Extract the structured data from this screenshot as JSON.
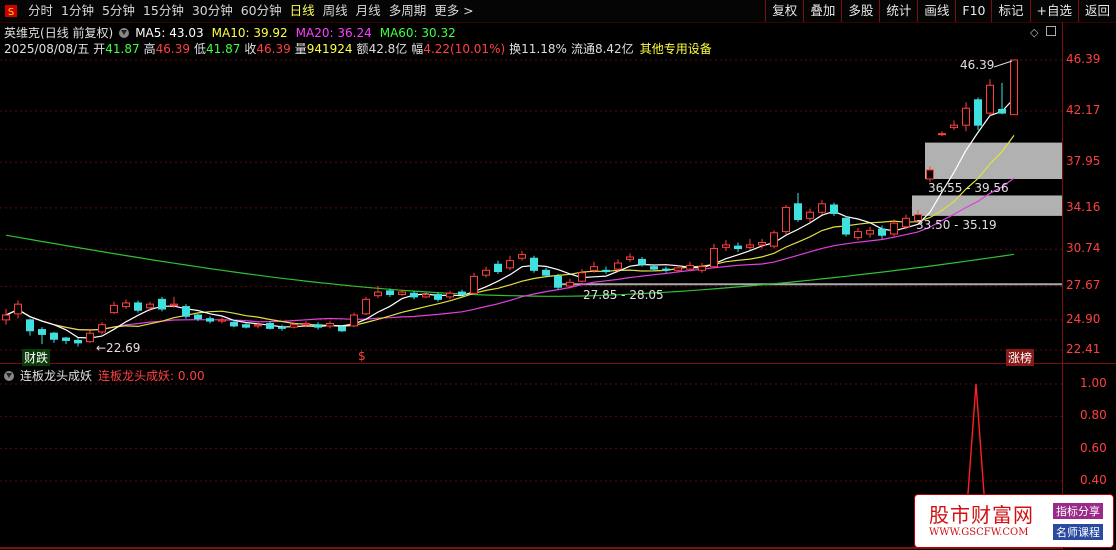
{
  "toolbar": {
    "left_items": [
      "分时",
      "1分钟",
      "5分钟",
      "15分钟",
      "30分钟",
      "60分钟",
      "日线",
      "周线",
      "月线",
      "多周期",
      "更多 >"
    ],
    "active_item": "日线",
    "right_buttons": [
      "复权",
      "叠加",
      "多股",
      "统计",
      "画线",
      "F10",
      "标记",
      "+自选",
      "返回"
    ]
  },
  "stock": {
    "name": "英维克",
    "mode": "(日线 前复权)",
    "ma": [
      {
        "label": "MA5: 43.03",
        "color": "#ffffff"
      },
      {
        "label": "MA10: 39.92",
        "color": "#ffff40"
      },
      {
        "label": "MA20: 36.24",
        "color": "#ff40ff"
      },
      {
        "label": "MA60: 30.32",
        "color": "#40ff40"
      }
    ],
    "date": "2025/08/08/五",
    "quote": [
      {
        "label": "开",
        "value": "41.87",
        "color": "#40ff40"
      },
      {
        "label": "高",
        "value": "46.39",
        "color": "#ff4040"
      },
      {
        "label": "低",
        "value": "41.87",
        "color": "#40ff40"
      },
      {
        "label": "收",
        "value": "46.39",
        "color": "#ff4040"
      },
      {
        "label": "量",
        "value": "941924",
        "color": "#ffff40"
      },
      {
        "label": "额",
        "value": "42.8亿",
        "color": "#dddddd"
      },
      {
        "label": "幅",
        "value": "4.22(10.01%)",
        "color": "#ff4040"
      },
      {
        "label": "换",
        "value": "11.18%",
        "color": "#dddddd"
      },
      {
        "label": "流通",
        "value": "8.42亿",
        "color": "#dddddd"
      }
    ],
    "concept": "其他专用设备"
  },
  "price_axis": [
    "46.39",
    "42.17",
    "37.95",
    "34.16",
    "30.74",
    "27.67",
    "24.90",
    "22.41"
  ],
  "annotations": {
    "high_label": "46.39",
    "low_label": "←22.69",
    "zone1": "36.55 - 39.56",
    "zone2": "33.50 - 35.19",
    "zone3": "27.85 - 28.05",
    "bottom_left_tag": "财跌",
    "bottom_mid_tag": "$",
    "bottom_right_tag": "涨榜"
  },
  "indicator": {
    "name": "连板龙头成妖",
    "value_label": "连板龙头成妖: 0.00",
    "axis": [
      "1.00",
      "0.80",
      "0.60",
      "0.40"
    ]
  },
  "watermark": {
    "main": "股市财富网",
    "url": "WWW.GSCFW.COM",
    "badge1": "指标分享",
    "badge2": "名师课程"
  },
  "chart_data": {
    "type": "candlestick",
    "price_axis_ticks": [
      46.39,
      42.17,
      37.95,
      34.16,
      30.74,
      27.67,
      24.9,
      22.41
    ],
    "candles": [
      {
        "o": 24.9,
        "c": 25.3,
        "h": 25.8,
        "l": 24.5
      },
      {
        "o": 25.4,
        "c": 26.2,
        "h": 26.5,
        "l": 25.0
      },
      {
        "o": 24.9,
        "c": 24.0,
        "h": 25.0,
        "l": 23.6
      },
      {
        "o": 24.1,
        "c": 23.7,
        "h": 24.3,
        "l": 22.9
      },
      {
        "o": 23.8,
        "c": 23.3,
        "h": 23.9,
        "l": 23.0
      },
      {
        "o": 23.4,
        "c": 23.2,
        "h": 23.5,
        "l": 22.9
      },
      {
        "o": 23.2,
        "c": 23.0,
        "h": 23.4,
        "l": 22.69
      },
      {
        "o": 23.1,
        "c": 23.8,
        "h": 24.0,
        "l": 23.0
      },
      {
        "o": 23.9,
        "c": 24.5,
        "h": 24.7,
        "l": 23.7
      },
      {
        "o": 25.5,
        "c": 26.1,
        "h": 26.4,
        "l": 25.4
      },
      {
        "o": 26.0,
        "c": 26.3,
        "h": 26.6,
        "l": 25.8
      },
      {
        "o": 26.3,
        "c": 25.7,
        "h": 26.5,
        "l": 25.5
      },
      {
        "o": 25.9,
        "c": 26.2,
        "h": 26.4,
        "l": 25.6
      },
      {
        "o": 26.6,
        "c": 25.8,
        "h": 26.8,
        "l": 25.6
      },
      {
        "o": 26.1,
        "c": 26.2,
        "h": 26.8,
        "l": 25.9
      },
      {
        "o": 26.0,
        "c": 25.2,
        "h": 26.2,
        "l": 25.0
      },
      {
        "o": 25.3,
        "c": 25.0,
        "h": 25.4,
        "l": 24.8
      },
      {
        "o": 25.0,
        "c": 24.8,
        "h": 25.2,
        "l": 24.6
      },
      {
        "o": 24.8,
        "c": 24.9,
        "h": 25.1,
        "l": 24.6
      },
      {
        "o": 24.7,
        "c": 24.4,
        "h": 24.9,
        "l": 24.3
      },
      {
        "o": 24.5,
        "c": 24.3,
        "h": 24.7,
        "l": 24.2
      },
      {
        "o": 24.4,
        "c": 24.5,
        "h": 24.7,
        "l": 24.2
      },
      {
        "o": 24.6,
        "c": 24.2,
        "h": 24.8,
        "l": 24.1
      },
      {
        "o": 24.3,
        "c": 24.2,
        "h": 24.5,
        "l": 24.0
      },
      {
        "o": 24.3,
        "c": 24.5,
        "h": 24.7,
        "l": 24.2
      },
      {
        "o": 24.5,
        "c": 24.6,
        "h": 24.8,
        "l": 24.3
      },
      {
        "o": 24.5,
        "c": 24.3,
        "h": 24.7,
        "l": 24.1
      },
      {
        "o": 24.4,
        "c": 24.6,
        "h": 24.8,
        "l": 24.2
      },
      {
        "o": 24.3,
        "c": 24.0,
        "h": 24.4,
        "l": 23.9
      },
      {
        "o": 24.4,
        "c": 25.3,
        "h": 25.5,
        "l": 24.3
      },
      {
        "o": 25.4,
        "c": 26.6,
        "h": 26.8,
        "l": 25.3
      },
      {
        "o": 26.9,
        "c": 27.2,
        "h": 27.7,
        "l": 26.7
      },
      {
        "o": 27.3,
        "c": 27.0,
        "h": 27.5,
        "l": 26.8
      },
      {
        "o": 27.0,
        "c": 27.2,
        "h": 27.4,
        "l": 26.9
      },
      {
        "o": 27.1,
        "c": 26.8,
        "h": 27.3,
        "l": 26.6
      },
      {
        "o": 26.8,
        "c": 27.0,
        "h": 27.2,
        "l": 26.7
      },
      {
        "o": 27.0,
        "c": 26.6,
        "h": 27.2,
        "l": 26.4
      },
      {
        "o": 26.8,
        "c": 27.1,
        "h": 27.3,
        "l": 26.6
      },
      {
        "o": 27.2,
        "c": 27.0,
        "h": 27.4,
        "l": 26.9
      },
      {
        "o": 27.1,
        "c": 28.5,
        "h": 28.8,
        "l": 27.0
      },
      {
        "o": 28.6,
        "c": 29.0,
        "h": 29.3,
        "l": 28.4
      },
      {
        "o": 29.5,
        "c": 28.9,
        "h": 29.8,
        "l": 28.7
      },
      {
        "o": 29.2,
        "c": 29.8,
        "h": 30.2,
        "l": 29.0
      },
      {
        "o": 30.0,
        "c": 30.3,
        "h": 30.6,
        "l": 29.8
      },
      {
        "o": 30.0,
        "c": 29.0,
        "h": 30.2,
        "l": 28.8
      },
      {
        "o": 29.0,
        "c": 28.6,
        "h": 29.2,
        "l": 28.4
      },
      {
        "o": 28.5,
        "c": 27.6,
        "h": 28.7,
        "l": 27.4
      },
      {
        "o": 27.7,
        "c": 28.0,
        "h": 28.3,
        "l": 27.5
      },
      {
        "o": 28.1,
        "c": 28.8,
        "h": 29.1,
        "l": 28.0
      },
      {
        "o": 29.0,
        "c": 29.3,
        "h": 29.7,
        "l": 28.8
      },
      {
        "o": 29.0,
        "c": 28.9,
        "h": 29.3,
        "l": 28.7
      },
      {
        "o": 29.1,
        "c": 29.6,
        "h": 29.9,
        "l": 28.9
      },
      {
        "o": 29.9,
        "c": 30.1,
        "h": 30.4,
        "l": 29.7
      },
      {
        "o": 29.9,
        "c": 29.5,
        "h": 30.1,
        "l": 29.3
      },
      {
        "o": 29.3,
        "c": 29.1,
        "h": 29.5,
        "l": 28.9
      },
      {
        "o": 29.1,
        "c": 29.0,
        "h": 29.3,
        "l": 28.8
      },
      {
        "o": 29.0,
        "c": 29.2,
        "h": 29.4,
        "l": 28.8
      },
      {
        "o": 29.1,
        "c": 29.4,
        "h": 29.7,
        "l": 28.9
      },
      {
        "o": 29.0,
        "c": 29.3,
        "h": 29.6,
        "l": 28.8
      },
      {
        "o": 29.3,
        "c": 30.8,
        "h": 31.2,
        "l": 29.2
      },
      {
        "o": 30.9,
        "c": 31.1,
        "h": 31.5,
        "l": 30.6
      },
      {
        "o": 31.0,
        "c": 30.8,
        "h": 31.3,
        "l": 30.5
      },
      {
        "o": 30.9,
        "c": 31.1,
        "h": 31.6,
        "l": 30.7
      },
      {
        "o": 31.1,
        "c": 31.3,
        "h": 31.6,
        "l": 30.8
      },
      {
        "o": 31.0,
        "c": 32.1,
        "h": 32.3,
        "l": 30.8
      },
      {
        "o": 32.2,
        "c": 34.2,
        "h": 34.4,
        "l": 32.0
      },
      {
        "o": 34.5,
        "c": 33.2,
        "h": 35.4,
        "l": 33.0
      },
      {
        "o": 33.3,
        "c": 33.8,
        "h": 34.1,
        "l": 33.0
      },
      {
        "o": 33.8,
        "c": 34.5,
        "h": 34.8,
        "l": 33.6
      },
      {
        "o": 34.4,
        "c": 33.7,
        "h": 34.6,
        "l": 33.5
      },
      {
        "o": 33.3,
        "c": 32.0,
        "h": 33.5,
        "l": 31.8
      },
      {
        "o": 31.7,
        "c": 32.2,
        "h": 32.5,
        "l": 31.5
      },
      {
        "o": 32.0,
        "c": 32.3,
        "h": 32.6,
        "l": 31.7
      },
      {
        "o": 32.4,
        "c": 31.9,
        "h": 32.7,
        "l": 31.6
      },
      {
        "o": 32.0,
        "c": 32.9,
        "h": 33.2,
        "l": 31.8
      },
      {
        "o": 32.6,
        "c": 33.3,
        "h": 33.6,
        "l": 32.4
      },
      {
        "o": 33.1,
        "c": 33.6,
        "h": 34.0,
        "l": 32.9
      },
      {
        "o": 36.55,
        "c": 37.3,
        "h": 37.6,
        "l": 36.3
      },
      {
        "o": 40.3,
        "c": 40.3,
        "h": 40.5,
        "l": 40.1
      },
      {
        "o": 40.8,
        "c": 41.0,
        "h": 41.4,
        "l": 40.6
      },
      {
        "o": 41.0,
        "c": 42.4,
        "h": 42.9,
        "l": 40.5
      },
      {
        "o": 43.1,
        "c": 41.0,
        "h": 43.3,
        "l": 40.6
      },
      {
        "o": 42.0,
        "c": 44.3,
        "h": 44.8,
        "l": 41.8
      },
      {
        "o": 42.3,
        "c": 42.0,
        "h": 44.5,
        "l": 41.9
      },
      {
        "o": 41.87,
        "c": 46.39,
        "h": 46.39,
        "l": 41.87
      }
    ],
    "indicator_spike": {
      "index": 77,
      "value": 1.0
    }
  }
}
